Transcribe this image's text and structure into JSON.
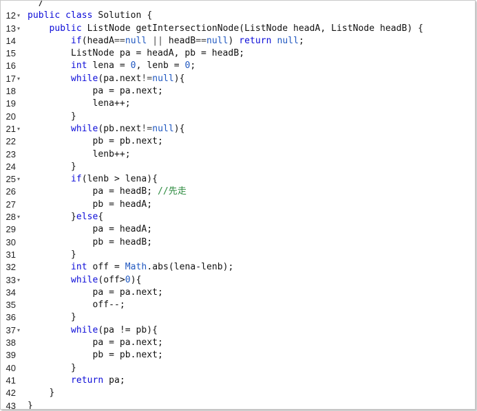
{
  "editor": {
    "fold_icon_glyph": "▾",
    "lines": [
      {
        "num": "",
        "fold": false,
        "tokens": [
          {
            "t": "plain",
            "v": "  /"
          }
        ]
      },
      {
        "num": "12",
        "fold": true,
        "tokens": [
          {
            "t": "kw",
            "v": "public"
          },
          {
            "t": "plain",
            "v": " "
          },
          {
            "t": "kw",
            "v": "class"
          },
          {
            "t": "plain",
            "v": " Solution {"
          }
        ]
      },
      {
        "num": "13",
        "fold": true,
        "tokens": [
          {
            "t": "plain",
            "v": "    "
          },
          {
            "t": "kw",
            "v": "public"
          },
          {
            "t": "plain",
            "v": " ListNode getIntersectionNode(ListNode headA, ListNode headB) {"
          }
        ]
      },
      {
        "num": "14",
        "fold": false,
        "tokens": [
          {
            "t": "plain",
            "v": "        "
          },
          {
            "t": "kw",
            "v": "if"
          },
          {
            "t": "plain",
            "v": "(headA"
          },
          {
            "t": "op",
            "v": "=="
          },
          {
            "t": "lit",
            "v": "null"
          },
          {
            "t": "plain",
            "v": " "
          },
          {
            "t": "op",
            "v": "||"
          },
          {
            "t": "plain",
            "v": " headB"
          },
          {
            "t": "op",
            "v": "=="
          },
          {
            "t": "lit",
            "v": "null"
          },
          {
            "t": "plain",
            "v": ") "
          },
          {
            "t": "kw",
            "v": "return"
          },
          {
            "t": "plain",
            "v": " "
          },
          {
            "t": "lit",
            "v": "null"
          },
          {
            "t": "plain",
            "v": ";"
          }
        ]
      },
      {
        "num": "15",
        "fold": false,
        "tokens": [
          {
            "t": "plain",
            "v": "        ListNode pa = headA, pb = headB;"
          }
        ]
      },
      {
        "num": "16",
        "fold": false,
        "tokens": [
          {
            "t": "plain",
            "v": "        "
          },
          {
            "t": "kw",
            "v": "int"
          },
          {
            "t": "plain",
            "v": " lena = "
          },
          {
            "t": "lit",
            "v": "0"
          },
          {
            "t": "plain",
            "v": ", lenb = "
          },
          {
            "t": "lit",
            "v": "0"
          },
          {
            "t": "plain",
            "v": ";"
          }
        ]
      },
      {
        "num": "17",
        "fold": true,
        "tokens": [
          {
            "t": "plain",
            "v": "        "
          },
          {
            "t": "kw",
            "v": "while"
          },
          {
            "t": "plain",
            "v": "(pa.next"
          },
          {
            "t": "op",
            "v": "!="
          },
          {
            "t": "lit",
            "v": "null"
          },
          {
            "t": "plain",
            "v": "){"
          }
        ]
      },
      {
        "num": "18",
        "fold": false,
        "tokens": [
          {
            "t": "plain",
            "v": "            pa = pa.next;"
          }
        ]
      },
      {
        "num": "19",
        "fold": false,
        "tokens": [
          {
            "t": "plain",
            "v": "            lena++;"
          }
        ]
      },
      {
        "num": "20",
        "fold": false,
        "tokens": [
          {
            "t": "plain",
            "v": "        }"
          }
        ]
      },
      {
        "num": "21",
        "fold": true,
        "tokens": [
          {
            "t": "plain",
            "v": "        "
          },
          {
            "t": "kw",
            "v": "while"
          },
          {
            "t": "plain",
            "v": "(pb.next"
          },
          {
            "t": "op",
            "v": "!="
          },
          {
            "t": "lit",
            "v": "null"
          },
          {
            "t": "plain",
            "v": "){"
          }
        ]
      },
      {
        "num": "22",
        "fold": false,
        "tokens": [
          {
            "t": "plain",
            "v": "            pb = pb.next;"
          }
        ]
      },
      {
        "num": "23",
        "fold": false,
        "tokens": [
          {
            "t": "plain",
            "v": "            lenb++;"
          }
        ]
      },
      {
        "num": "24",
        "fold": false,
        "tokens": [
          {
            "t": "plain",
            "v": "        }"
          }
        ]
      },
      {
        "num": "25",
        "fold": true,
        "tokens": [
          {
            "t": "plain",
            "v": "        "
          },
          {
            "t": "kw",
            "v": "if"
          },
          {
            "t": "plain",
            "v": "(lenb > lena){"
          }
        ]
      },
      {
        "num": "26",
        "fold": false,
        "tokens": [
          {
            "t": "plain",
            "v": "            pa = headB; "
          },
          {
            "t": "cm",
            "v": "//先走"
          }
        ]
      },
      {
        "num": "27",
        "fold": false,
        "tokens": [
          {
            "t": "plain",
            "v": "            pb = headA;"
          }
        ]
      },
      {
        "num": "28",
        "fold": true,
        "tokens": [
          {
            "t": "plain",
            "v": "        }"
          },
          {
            "t": "kw",
            "v": "else"
          },
          {
            "t": "plain",
            "v": "{"
          }
        ]
      },
      {
        "num": "29",
        "fold": false,
        "tokens": [
          {
            "t": "plain",
            "v": "            pa = headA;"
          }
        ]
      },
      {
        "num": "30",
        "fold": false,
        "tokens": [
          {
            "t": "plain",
            "v": "            pb = headB;"
          }
        ]
      },
      {
        "num": "31",
        "fold": false,
        "tokens": [
          {
            "t": "plain",
            "v": "        }"
          }
        ]
      },
      {
        "num": "32",
        "fold": false,
        "tokens": [
          {
            "t": "plain",
            "v": "        "
          },
          {
            "t": "kw",
            "v": "int"
          },
          {
            "t": "plain",
            "v": " off = "
          },
          {
            "t": "cls",
            "v": "Math"
          },
          {
            "t": "plain",
            "v": ".abs(lena-lenb);"
          }
        ]
      },
      {
        "num": "33",
        "fold": true,
        "tokens": [
          {
            "t": "plain",
            "v": "        "
          },
          {
            "t": "kw",
            "v": "while"
          },
          {
            "t": "plain",
            "v": "(off>"
          },
          {
            "t": "lit",
            "v": "0"
          },
          {
            "t": "plain",
            "v": "){"
          }
        ]
      },
      {
        "num": "34",
        "fold": false,
        "tokens": [
          {
            "t": "plain",
            "v": "            pa = pa.next;"
          }
        ]
      },
      {
        "num": "35",
        "fold": false,
        "tokens": [
          {
            "t": "plain",
            "v": "            off--;"
          }
        ]
      },
      {
        "num": "36",
        "fold": false,
        "tokens": [
          {
            "t": "plain",
            "v": "        }"
          }
        ]
      },
      {
        "num": "37",
        "fold": true,
        "tokens": [
          {
            "t": "plain",
            "v": "        "
          },
          {
            "t": "kw",
            "v": "while"
          },
          {
            "t": "plain",
            "v": "(pa != pb){"
          }
        ]
      },
      {
        "num": "38",
        "fold": false,
        "tokens": [
          {
            "t": "plain",
            "v": "            pa = pa.next;"
          }
        ]
      },
      {
        "num": "39",
        "fold": false,
        "tokens": [
          {
            "t": "plain",
            "v": "            pb = pb.next;"
          }
        ]
      },
      {
        "num": "40",
        "fold": false,
        "tokens": [
          {
            "t": "plain",
            "v": "        }"
          }
        ]
      },
      {
        "num": "41",
        "fold": false,
        "tokens": [
          {
            "t": "plain",
            "v": "        "
          },
          {
            "t": "kw",
            "v": "return"
          },
          {
            "t": "plain",
            "v": " pa;"
          }
        ]
      },
      {
        "num": "42",
        "fold": false,
        "tokens": [
          {
            "t": "plain",
            "v": "    }"
          }
        ]
      },
      {
        "num": "43",
        "fold": false,
        "tokens": [
          {
            "t": "plain",
            "v": "}"
          }
        ]
      }
    ]
  }
}
